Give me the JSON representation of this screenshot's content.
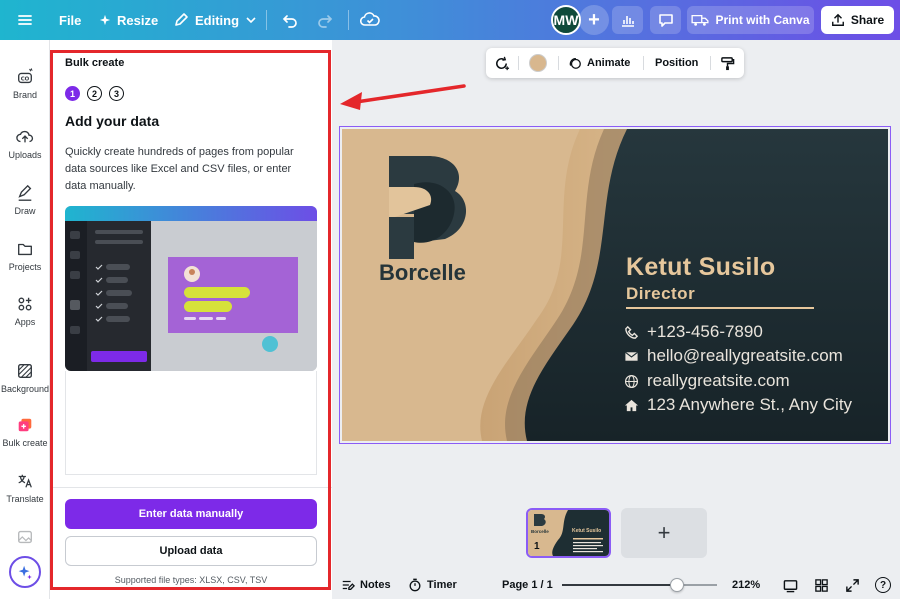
{
  "topbar": {
    "file_label": "File",
    "resize_label": "Resize",
    "editing_label": "Editing",
    "avatar_initials": "MW",
    "print_label": "Print with Canva",
    "share_label": "Share"
  },
  "rail": {
    "items": [
      {
        "label": "Brand",
        "icon": "brand-icon"
      },
      {
        "label": "Uploads",
        "icon": "upload-icon"
      },
      {
        "label": "Draw",
        "icon": "draw-icon"
      },
      {
        "label": "Projects",
        "icon": "folder-icon"
      },
      {
        "label": "Apps",
        "icon": "apps-icon"
      },
      {
        "label": "Background",
        "icon": "background-icon"
      },
      {
        "label": "Bulk create",
        "icon": "bulk-create-icon"
      },
      {
        "label": "Translate",
        "icon": "translate-icon"
      }
    ]
  },
  "panel": {
    "title": "Bulk create",
    "steps": [
      "1",
      "2",
      "3"
    ],
    "heading": "Add your data",
    "description": "Quickly create hundreds of pages from popular data sources like Excel and CSV files, or enter data manually.",
    "enter_manually_label": "Enter data manually",
    "upload_label": "Upload data",
    "supported": "Supported file types: XLSX, CSV, TSV"
  },
  "context_toolbar": {
    "animate_label": "Animate",
    "position_label": "Position",
    "swatch_color": "#d8b78e"
  },
  "card": {
    "brand": "Borcelle",
    "name": "Ketut Susilo",
    "role": "Director",
    "phone": "+123-456-7890",
    "email": "hello@reallygreatsite.com",
    "website": "reallygreatsite.com",
    "address": "123 Anywhere St., Any City",
    "colors": {
      "tan": "#d8b88f",
      "dark": "#1e2e33",
      "gold": "#e6c79c"
    }
  },
  "pages": {
    "thumb_number": "1",
    "thumb_brand": "Borcelle",
    "thumb_name": "Ketut Susilo",
    "add_symbol": "+"
  },
  "footer": {
    "notes_label": "Notes",
    "timer_label": "Timer",
    "page_label": "Page 1 / 1",
    "zoom_label": "212%",
    "zoom_fraction": 0.74,
    "help_label": "?"
  }
}
